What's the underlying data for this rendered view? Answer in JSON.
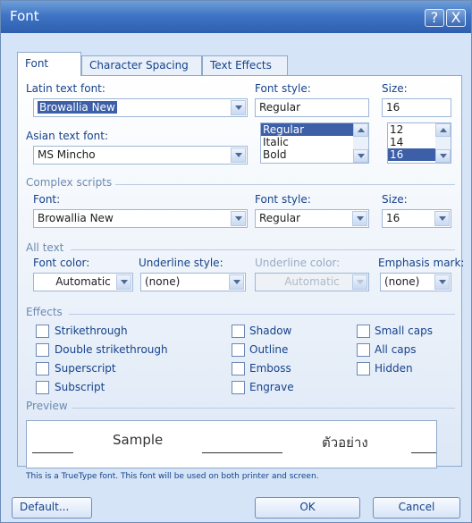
{
  "window": {
    "title": "Font",
    "help_label": "?",
    "close_label": "X"
  },
  "tabs": [
    "Font",
    "Character Spacing",
    "Text Effects"
  ],
  "latin": {
    "font_label": "Latin text font:",
    "font_value": "Browallia New",
    "style_label": "Font style:",
    "style_value": "Regular",
    "style_options": [
      "Regular",
      "Italic",
      "Bold"
    ],
    "size_label": "Size:",
    "size_value": "16",
    "size_options": [
      "12",
      "14",
      "16"
    ]
  },
  "asian": {
    "font_label": "Asian text font:",
    "font_value": "MS Mincho"
  },
  "complex": {
    "section_label": "Complex scripts",
    "font_label": "Font:",
    "font_value": "Browallia New",
    "style_label": "Font style:",
    "style_value": "Regular",
    "size_label": "Size:",
    "size_value": "16"
  },
  "all_text": {
    "section_label": "All text",
    "font_color_label": "Font color:",
    "font_color_value": "Automatic",
    "underline_style_label": "Underline style:",
    "underline_style_value": "(none)",
    "underline_color_label": "Underline color:",
    "underline_color_value": "Automatic",
    "emphasis_label": "Emphasis mark:",
    "emphasis_value": "(none)"
  },
  "effects": {
    "section_label": "Effects",
    "items": [
      "Strikethrough",
      "Double strikethrough",
      "Superscript",
      "Subscript",
      "Shadow",
      "Outline",
      "Emboss",
      "Engrave",
      "Small caps",
      "All caps",
      "Hidden"
    ]
  },
  "preview": {
    "section_label": "Preview",
    "sample_text": "Sample",
    "thai_sample": "ตัวอย่าง",
    "note": "This is a TrueType font. This font will be used on both printer and screen."
  },
  "buttons": {
    "default": "Default...",
    "ok": "OK",
    "cancel": "Cancel"
  },
  "colors": {
    "titlebar": "#3f74c4",
    "dialog_bg": "#d5e4f6",
    "label": "#15428b",
    "selection": "#3c5fa8"
  }
}
